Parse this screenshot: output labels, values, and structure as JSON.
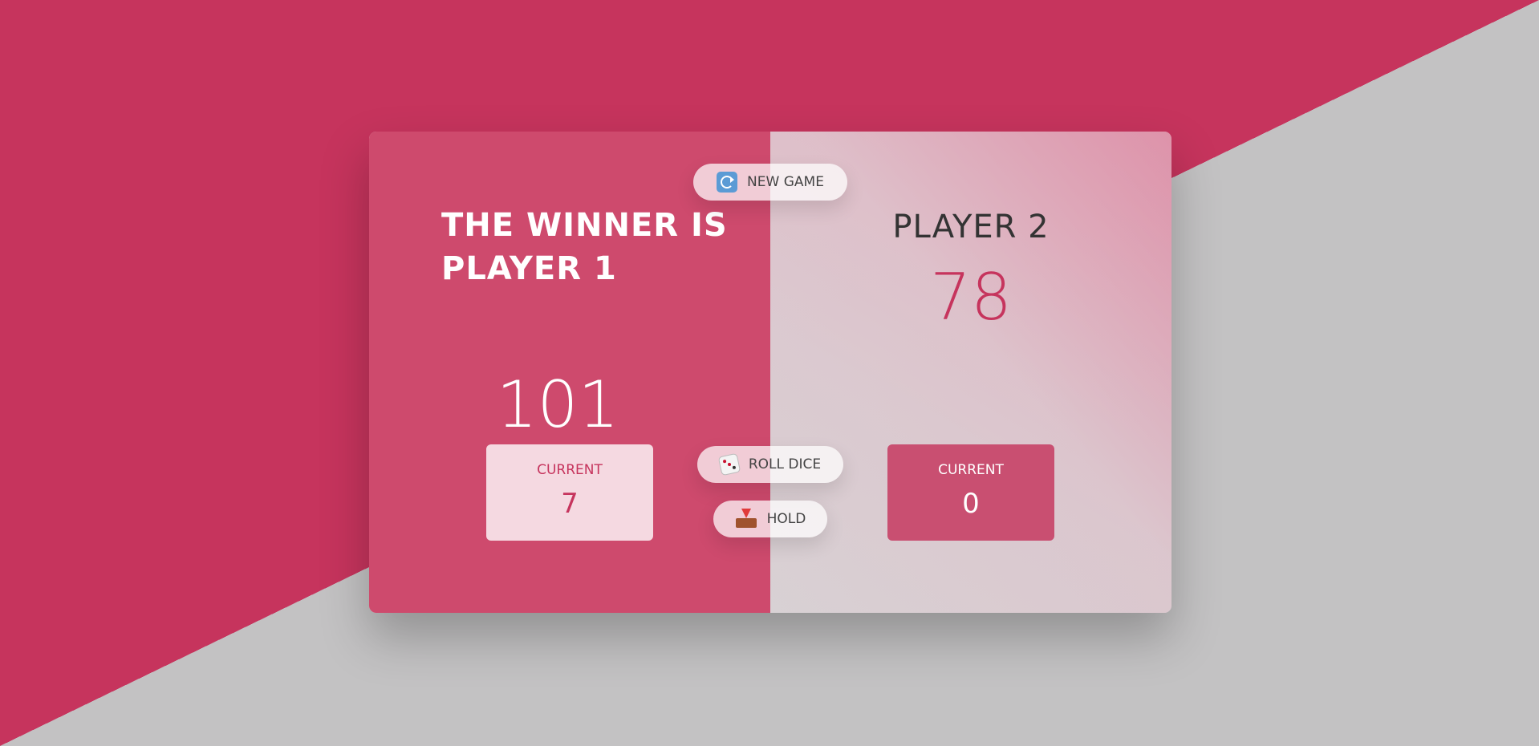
{
  "buttons": {
    "new_game": {
      "label": "NEW GAME",
      "icon": "new-game-icon"
    },
    "roll_dice": {
      "label": "ROLL DICE",
      "icon": "dice-icon"
    },
    "hold": {
      "label": "HOLD",
      "icon": "inbox-tray-icon"
    }
  },
  "players": [
    {
      "name": "THE WINNER IS PLAYER 1",
      "score": "101",
      "current_label": "CURRENT",
      "current_score": "7",
      "winner": true
    },
    {
      "name": "PLAYER 2",
      "score": "78",
      "current_label": "CURRENT",
      "current_score": "0",
      "winner": false
    }
  ],
  "colors": {
    "accent": "#c6345d",
    "winner_panel": "#ce4a6d",
    "background_gray": "#c3c2c3"
  }
}
